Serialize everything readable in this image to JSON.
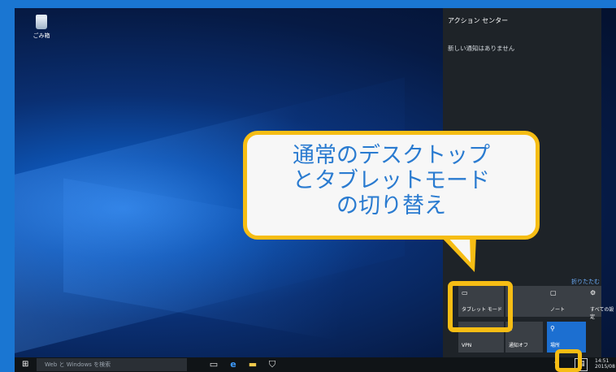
{
  "desktop": {
    "recycle_bin_label": "ごみ箱"
  },
  "action_center": {
    "title": "アクション センター",
    "empty_message": "新しい通知はありません",
    "collapse_label": "折りたたむ",
    "tiles": [
      {
        "label": "タブレット モード",
        "icon": "tablet-mode-icon"
      },
      {
        "label": "ノート",
        "icon": "note-icon"
      },
      {
        "label": "すべての設定",
        "icon": "settings-icon"
      },
      {
        "label": "VPN",
        "icon": "vpn-icon"
      },
      {
        "label": "通知オフ",
        "icon": "quiet-hours-icon"
      },
      {
        "label": "場所",
        "icon": "location-icon"
      }
    ]
  },
  "taskbar": {
    "search_placeholder": "Web と Windows を検索",
    "clock_time": "14:51",
    "clock_date": "2015/08"
  },
  "callout": {
    "line1": "通常のデスクトップ",
    "line2": "とタブレットモード",
    "line3": "の切り替え"
  },
  "colors": {
    "highlight": "#f6bd14",
    "callout_text": "#2a7bd0",
    "accent_tile": "#1c6fd1"
  }
}
